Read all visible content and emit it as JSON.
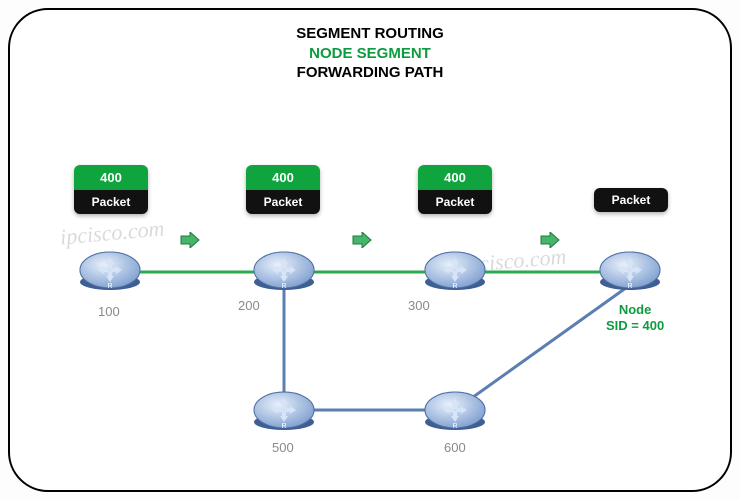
{
  "title": {
    "line1": "SEGMENT ROUTING",
    "line2": "NODE SEGMENT",
    "line3": "FORWARDING PATH"
  },
  "labels": {
    "segment": "400",
    "packet": "Packet"
  },
  "routers": {
    "r1": "100",
    "r2": "200",
    "r3": "300",
    "r4": "",
    "r5": "500",
    "r6": "600"
  },
  "nodeSid": {
    "l1": "Node",
    "l2": "SID = 400"
  },
  "watermark": "ipcisco.com",
  "colors": {
    "green": "#10a43e",
    "link": "#5b7fb2",
    "active": "#2aa94f"
  }
}
